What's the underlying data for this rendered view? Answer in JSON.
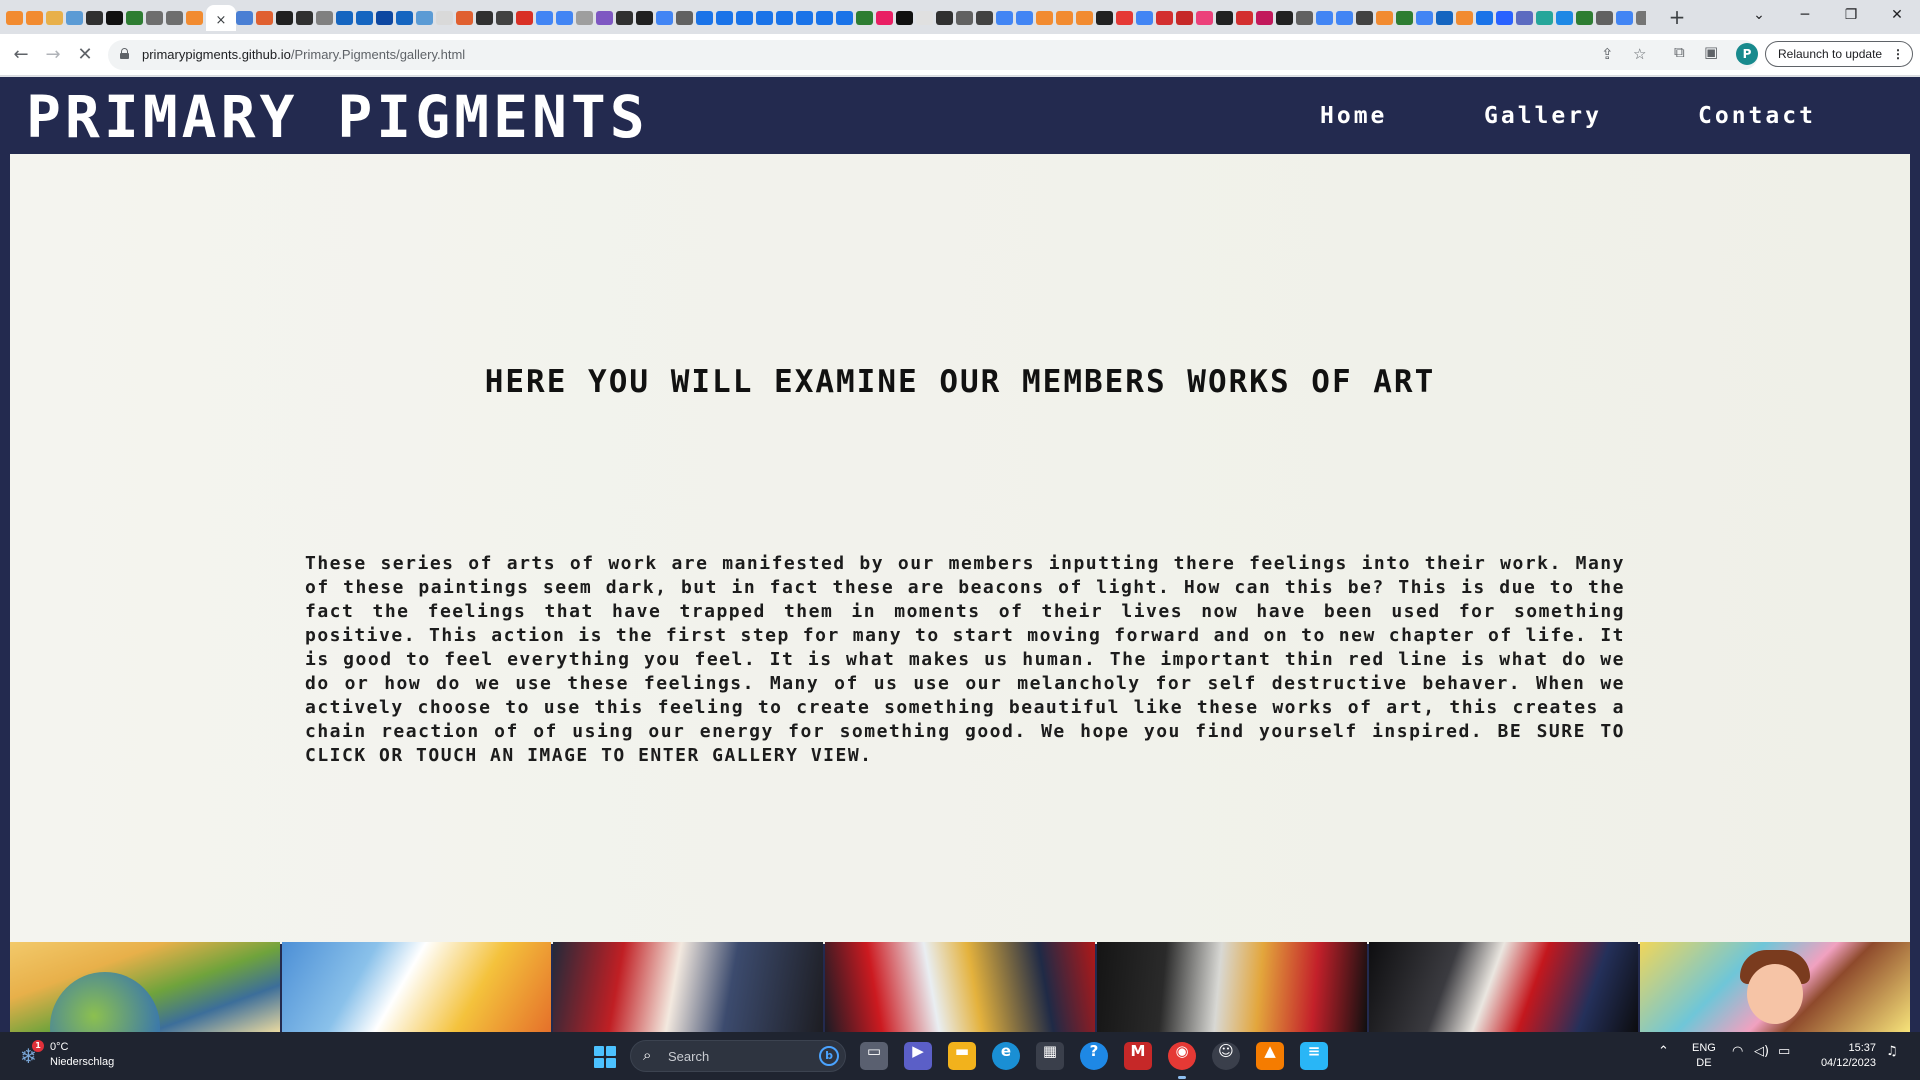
{
  "browser": {
    "active_tab_close": "×",
    "new_tab": "+",
    "tab_favicon_colors": [
      "#f28b30",
      "#f28b30",
      "#e8b04a",
      "#5b9bd5",
      "#303030",
      "#101010",
      "#2e7d32",
      "#6e6e6e",
      "#6e6e6e",
      "#f28b30",
      "#4a7fd4",
      "#e06030",
      "#202020",
      "#303030",
      "#808080",
      "#1565c0",
      "#1565c0",
      "#0d47a1",
      "#1565c0",
      "#5b9bd5",
      "#d9d9d9",
      "#e06030",
      "#303030",
      "#424242",
      "#d93025",
      "#4285f4",
      "#4285f4",
      "#9e9e9e",
      "#7e57c2",
      "#303030",
      "#202020",
      "#4285f4",
      "#616161",
      "#1a73e8",
      "#1a73e8",
      "#1a73e8",
      "#1a73e8",
      "#1a73e8",
      "#1a73e8",
      "#1a73e8",
      "#1a73e8",
      "#2e7d32",
      "#e91e63",
      "#101010",
      "#e0e0e0",
      "#303030",
      "#616161",
      "#424242",
      "#4285f4",
      "#4285f4",
      "#f28b30",
      "#f28b30",
      "#f28b30",
      "#212121",
      "#e53935",
      "#4285f4",
      "#d32f2f",
      "#c62828",
      "#ec407a",
      "#212121",
      "#d32f2f",
      "#c2185b",
      "#212121",
      "#616161",
      "#4285f4",
      "#4285f4",
      "#424242",
      "#f28b30",
      "#2e7d32",
      "#4285f4",
      "#1565c0",
      "#f28b30",
      "#1a73e8",
      "#2962ff",
      "#5c6bc0",
      "#26a69a",
      "#1e88e5",
      "#2e7d32",
      "#616161",
      "#4285f4",
      "#757575",
      "#616161",
      "#4285f4",
      "#f28b30"
    ],
    "address": {
      "host": "primarypigments.github.io",
      "path": "/Primary.Pigments/gallery.html"
    },
    "profile_initial": "P",
    "relaunch_label": "Relaunch to update"
  },
  "page": {
    "logo": "PRIMARY PIGMENTS",
    "nav": {
      "home": "Home",
      "gallery": "Gallery",
      "contact": "Contact"
    },
    "heading": "HERE YOU WILL EXAMINE OUR MEMBERS WORKS OF ART",
    "intro": "These series of arts of work are manifested by our members inputting there feelings into their work. Many of these paintings seem dark, but in fact these are beacons of light. How can this be? This is due to the fact the feelings that have trapped them in moments of their lives now have been used for something positive. This action is the first step for many to start moving forward and on to new chapter of life. It is good to feel everything you feel. It is what makes us human. The important thin red line is what do we do or how do we use these feelings. Many of us use our melancholy for self destructive behaver. When we actively choose to use this feeling to create something beautiful like these works of art, this creates a chain reaction of of using our energy for something good. We hope you find yourself inspired. BE SURE TO CLICK OR TOUCH AN IMAGE TO ENTER GALLERY VIEW.",
    "colors": {
      "header_bg": "#232a4f",
      "content_bg": "#f2f2ec",
      "text": "#111111"
    }
  },
  "taskbar": {
    "weather": {
      "temp": "0°C",
      "condition": "Niederschlag",
      "badge": "1"
    },
    "search_label": "Search",
    "language": {
      "line1": "ENG",
      "line2": "DE"
    },
    "clock": {
      "time": "15:37",
      "date": "04/12/2023"
    }
  }
}
